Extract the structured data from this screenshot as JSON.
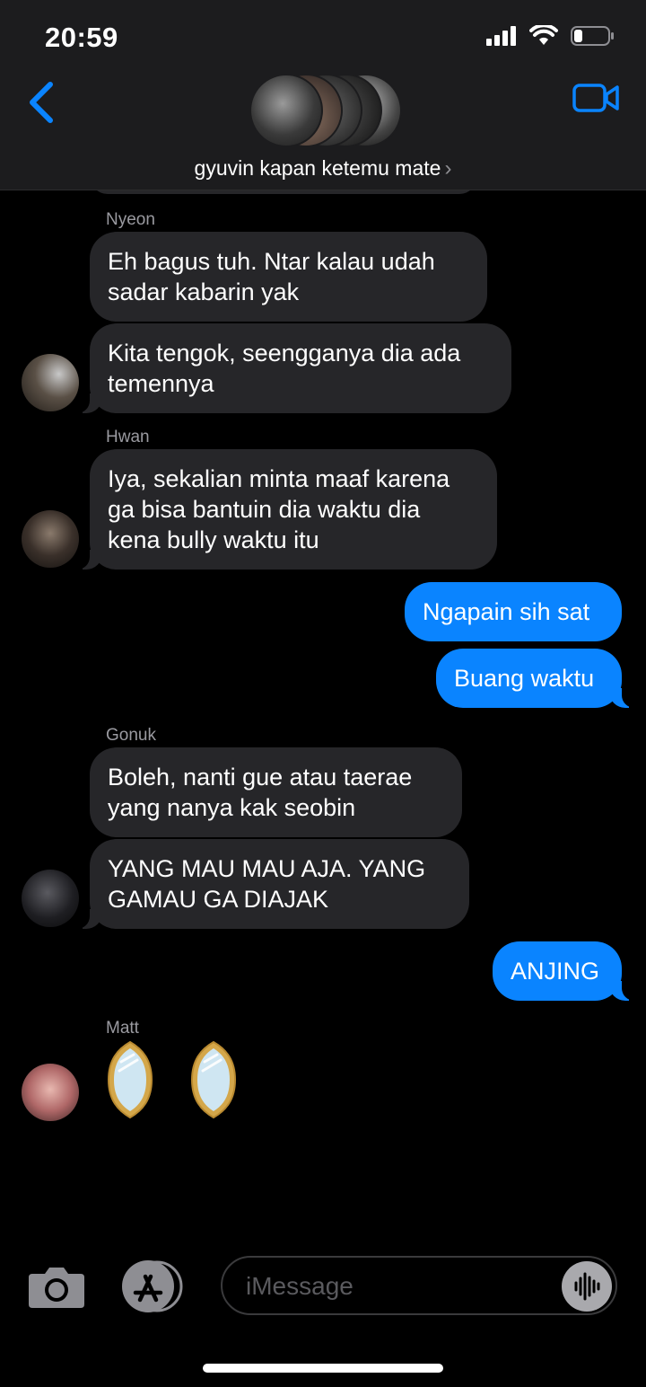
{
  "status_bar": {
    "time": "20:59",
    "battery_level": 0.25
  },
  "header": {
    "title": "gyuvin kapan ketemu mate",
    "chevron": "›"
  },
  "messages": [
    {
      "sender": "Nyeon",
      "bubbles": [
        "Eh bagus tuh. Ntar kalau udah sadar kabarin yak",
        "Kita tengok, seengganya dia ada temennya"
      ]
    },
    {
      "sender": "Hwan",
      "bubbles": [
        "Iya, sekalian minta maaf karena ga bisa bantuin dia waktu dia kena bully waktu itu"
      ]
    },
    {
      "sender": "me",
      "bubbles": [
        "Ngapain sih sat",
        "Buang waktu"
      ]
    },
    {
      "sender": "Gonuk",
      "bubbles": [
        "Boleh, nanti gue atau taerae yang nanya kak seobin",
        "YANG MAU MAU AJA. YANG GAMAU GA DIAJAK"
      ]
    },
    {
      "sender": "me",
      "bubbles": [
        "ANJING"
      ]
    },
    {
      "sender": "Matt",
      "bubbles": [
        "mirror-emoji mirror-emoji"
      ]
    }
  ],
  "input": {
    "placeholder": "iMessage"
  },
  "colors": {
    "outgoing": "#0a84ff",
    "incoming": "#262629",
    "accent": "#0a84ff"
  },
  "icons": [
    "back-chevron-icon",
    "video-camera-icon",
    "camera-icon",
    "app-store-icon",
    "audio-waveform-icon",
    "mirror-emoji-icon"
  ]
}
